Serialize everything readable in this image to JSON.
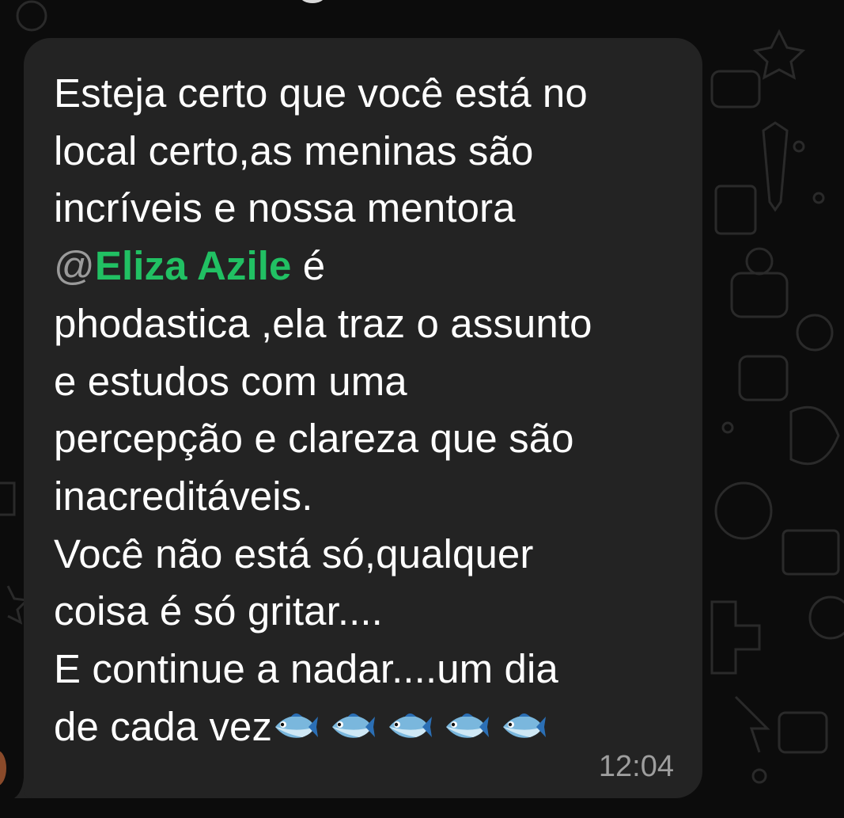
{
  "message": {
    "text_before_mention": "Esteja certo que você está no\nlocal certo,as meninas são\nincríveis e nossa mentora\n",
    "mention_at": "@",
    "mention_name": "Eliza Azile",
    "text_after_mention": " é\nphodastica ,ela traz o assunto\ne estudos com uma\npercepção e clareza que são\ninacreditáveis.\nVocê não está só,qualquer\ncoisa é só gritar....\nE continue a nadar....um dia\nde cada vez",
    "emoji": [
      "fish-emoji",
      "fish-emoji",
      "fish-emoji",
      "fish-emoji",
      "fish-emoji"
    ],
    "timestamp": "12:04"
  },
  "colors": {
    "bubble": "#232323",
    "mention": "#21c063",
    "text": "#ffffff",
    "timestamp": "#9e9e9e",
    "background": "#0c0c0c"
  }
}
